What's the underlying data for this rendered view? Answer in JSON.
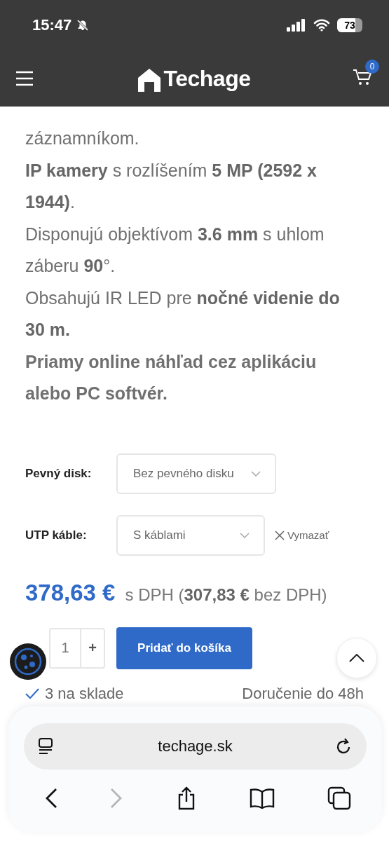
{
  "status_bar": {
    "time": "15:47",
    "battery": "73",
    "silent": true
  },
  "header": {
    "logo": "Techage",
    "cart_count": "0"
  },
  "description": [
    {
      "kind": "plain",
      "text": "záznamníkom."
    },
    {
      "kind": "plain",
      "text": "**IP kamery** s rozlíšením **5 MP (2592 x 1944)**."
    },
    {
      "kind": "plain",
      "text": "Disponujú objektívom **3.6 mm** s uhlom záberu **90**°."
    },
    {
      "kind": "plain",
      "text": "Obsahujú IR LED pre **nočné videnie do 30 m.**"
    },
    {
      "kind": "strong",
      "text": "Priamy online náhľad cez aplikáciu alebo PC softvér."
    }
  ],
  "options": [
    {
      "label": "Pevný disk:",
      "value": "Bez pevného disku"
    },
    {
      "label": "UTP káble:",
      "value": "S káblami",
      "clear": "Vymazať"
    }
  ],
  "price": {
    "gross": "378,63 €",
    "note": "s DPH (**307,83 €** bez DPH)"
  },
  "quantity": "1",
  "plus": "+",
  "add_to_cart": "Pridať do košíka",
  "stock": "3 na sklade",
  "delivery": "Doručenie do 48h",
  "browser": {
    "url": "techage.sk",
    "forward_disabled": true
  }
}
